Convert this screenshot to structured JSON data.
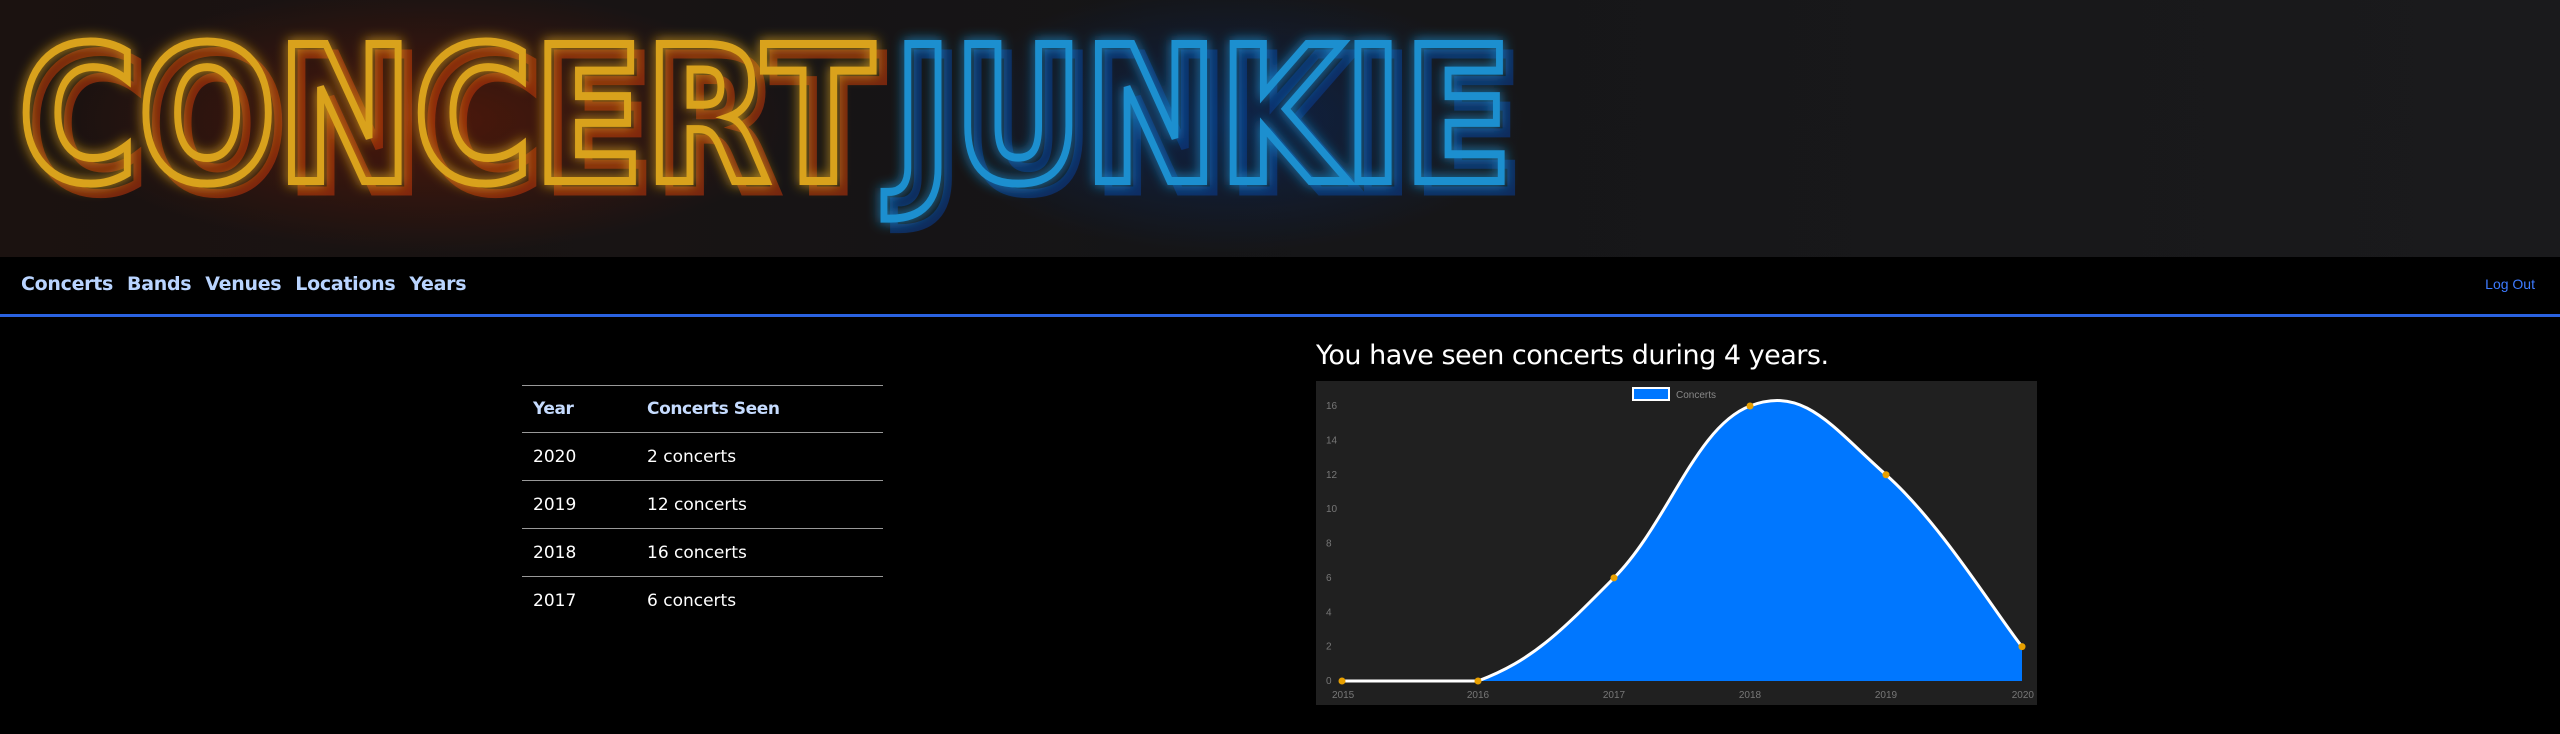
{
  "brand": {
    "logo_text": "CONCERT JUNKIE",
    "logo_part1": "CONCERT",
    "logo_part2": "JUNKIE",
    "color1": "#d9a21c",
    "color2": "#1f8fcf"
  },
  "nav": {
    "items": [
      {
        "label": "Concerts"
      },
      {
        "label": "Bands"
      },
      {
        "label": "Venues"
      },
      {
        "label": "Locations"
      },
      {
        "label": "Years"
      }
    ],
    "logout_label": "Log Out",
    "link_color": "#b9d4ff",
    "accent_color": "#2a62e0"
  },
  "years_table": {
    "headers": [
      "Year",
      "Concerts Seen"
    ],
    "rows": [
      {
        "year": "2020",
        "count": "2 concerts"
      },
      {
        "year": "2019",
        "count": "12 concerts"
      },
      {
        "year": "2018",
        "count": "16 concerts"
      },
      {
        "year": "2017",
        "count": "6 concerts"
      }
    ]
  },
  "summary": "You have seen concerts during 4 years.",
  "chart_data": {
    "type": "area",
    "x": [
      "2015",
      "2016",
      "2017",
      "2018",
      "2019",
      "2020"
    ],
    "series": [
      {
        "name": "Concerts",
        "values": [
          0,
          0,
          6,
          16,
          12,
          2
        ],
        "fill": "#0077ff",
        "stroke": "#ffffff",
        "point_color": "#e8a000"
      }
    ],
    "ylim": [
      0,
      16
    ],
    "yticks": [
      0,
      2,
      4,
      6,
      8,
      10,
      12,
      14,
      16
    ],
    "legend": "top-center",
    "grid": false,
    "title": "",
    "xlabel": "",
    "ylabel": ""
  }
}
